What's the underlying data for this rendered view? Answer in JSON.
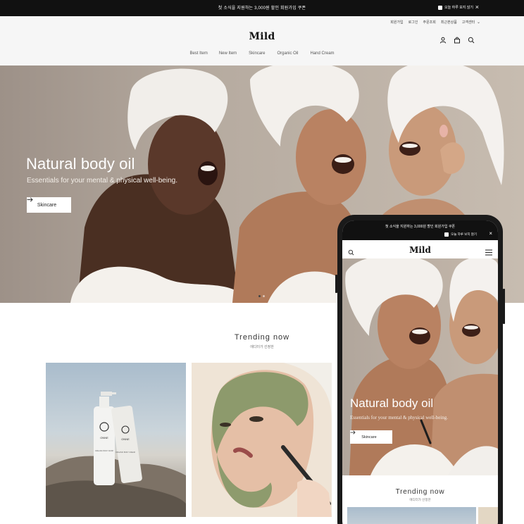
{
  "promo": {
    "text": "첫 소식을 지원하는 3,000원 할인 회원가입 쿠폰",
    "hide_today": "오늘 하루 보지 않기"
  },
  "header": {
    "logo": "Mild",
    "utility": [
      "회원가입",
      "로그인",
      "주문조회",
      "최근본상품",
      "고객센터"
    ],
    "nav": [
      "Best Item",
      "New Item",
      "Skincare",
      "Organic Oil",
      "Hand Cream"
    ]
  },
  "hero": {
    "title": "Natural body oil",
    "subtitle": "Essentials for your mental & physical well-being.",
    "button_label": "Skincare",
    "slide_count": 2,
    "active_slide": 1
  },
  "trending": {
    "title": "Trending now",
    "subtitle": "에디터가 선정한"
  },
  "product_labels": {
    "brand": "ONNE",
    "bottle_text": "ORGANIC BODY WASH",
    "tube_text": "ORGANIC BODY CREAM"
  },
  "mobile": {
    "promo_text": "첫 소식을 지원하는 3,000원 할인 회원가입 쿠폰",
    "hide_today": "오늘 하루 보지 않기",
    "logo": "Mild",
    "hero_title": "Natural body oil",
    "hero_subtitle": "Essentials for your mental & physical well-being.",
    "button_label": "Skincare",
    "trending_title": "Trending now",
    "trending_subtitle": "에디터가 선정한"
  },
  "colors": {
    "promo_bg": "#111111",
    "header_bg": "#f6f6f6",
    "hero_text": "#ffffff"
  },
  "icons": [
    "user-icon",
    "cart-icon",
    "search-icon",
    "close-icon",
    "arrow-right-icon",
    "menu-icon",
    "chevron-down-icon"
  ]
}
